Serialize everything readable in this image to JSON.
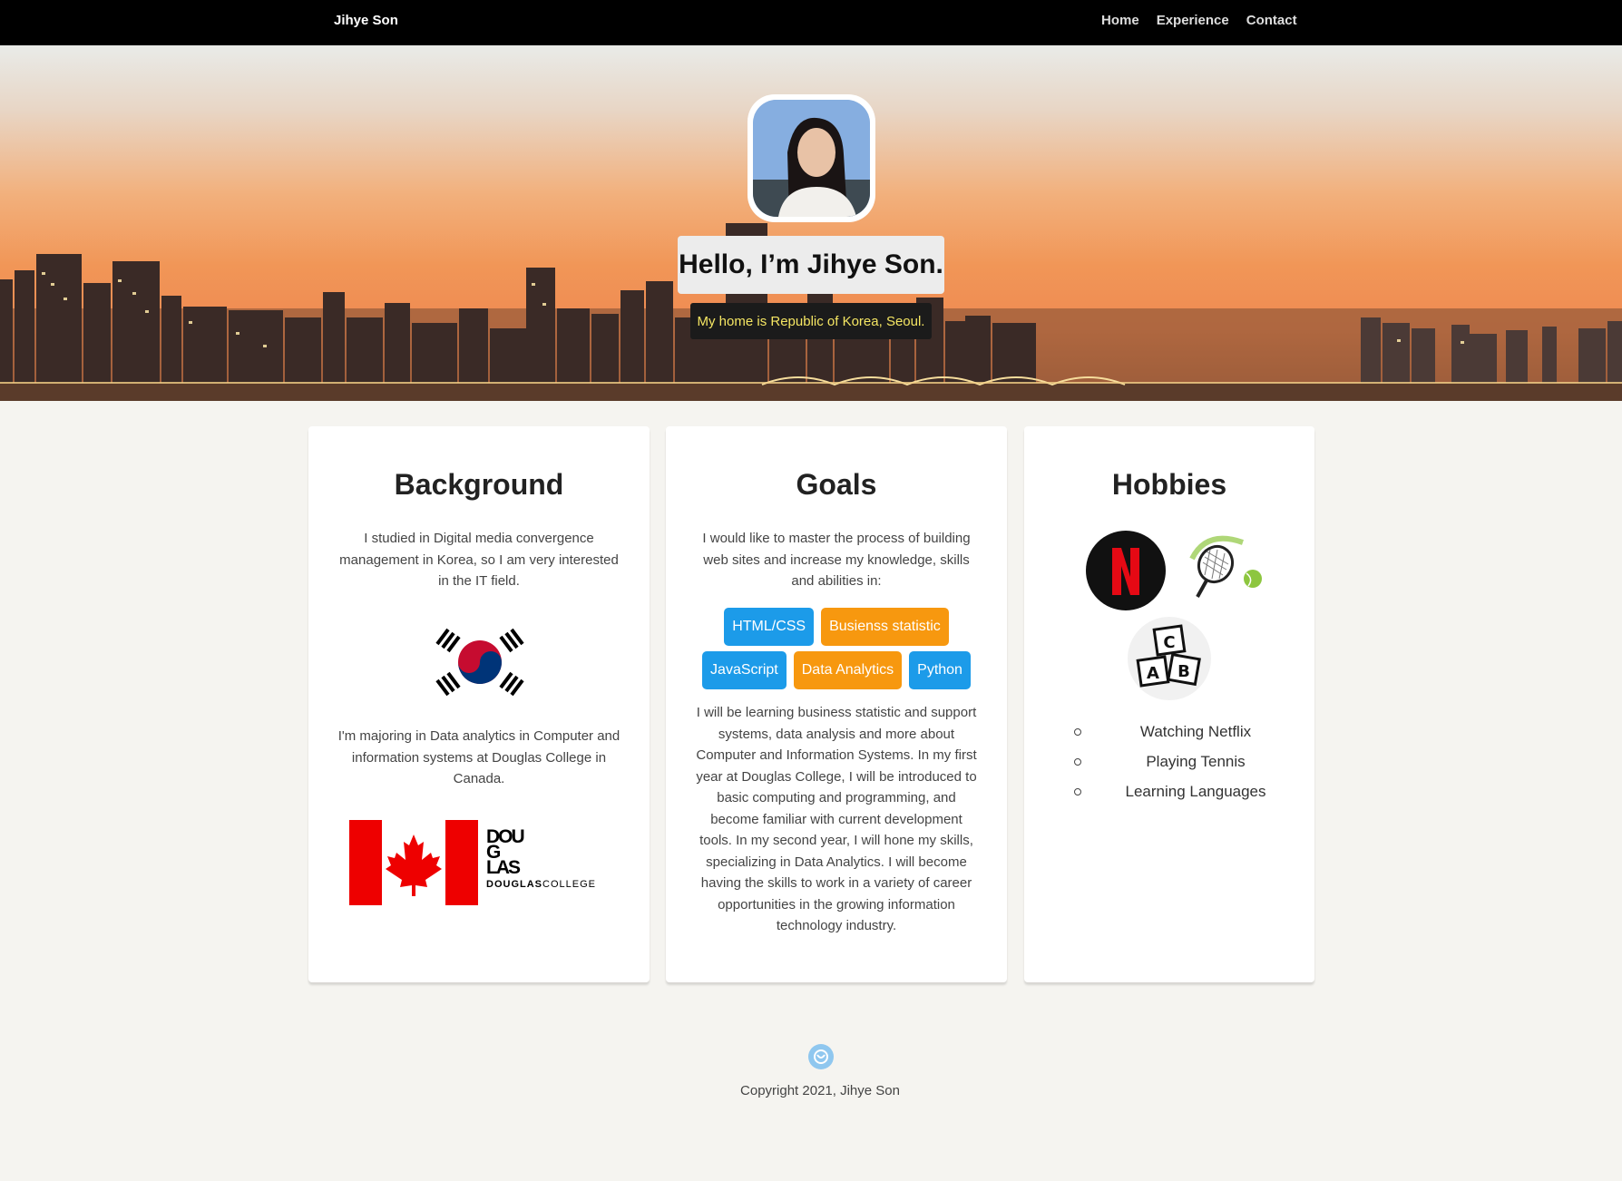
{
  "nav": {
    "brand": "Jihye Son",
    "links": [
      "Home",
      "Experience",
      "Contact"
    ]
  },
  "hero": {
    "title": "Hello, I’m Jihye Son.",
    "subtitle": "My home is Republic of Korea, Seoul."
  },
  "background": {
    "title": "Background",
    "p1": "I studied in Digital media convergence management in Korea, so I am very interested in the IT field.",
    "p2": "I'm majoring in Data analytics in Computer and information systems at Douglas College in Canada.",
    "douglas_mark": "DOUG LAS",
    "douglas_word_bold": "DOUGLAS",
    "douglas_word_light": "COLLEGE"
  },
  "goals": {
    "title": "Goals",
    "p1": "I would like to master the process of building web sites and increase my knowledge, skills and abilities in:",
    "skills_row1": [
      {
        "label": "HTML/CSS",
        "color": "#1c9be9"
      },
      {
        "label": "Busienss statistic",
        "color": "#f7980f"
      }
    ],
    "skills_row2": [
      {
        "label": "JavaScript",
        "color": "#1c9be9"
      },
      {
        "label": "Data Analytics",
        "color": "#f7980f"
      },
      {
        "label": "Python",
        "color": "#1c9be9"
      }
    ],
    "p2": "I will be learning business statistic and support systems, data analysis and more about Computer and Information Systems. In my first year at Douglas College, I will be introduced to basic computing and programming, and become familiar with current development tools. In my second year, I will hone my skills, specializing in Data Analytics. I will become having the skills to work in a variety of career opportunities in the growing information technology industry."
  },
  "hobbies": {
    "title": "Hobbies",
    "items": [
      "Watching Netflix",
      "Playing Tennis",
      "Learning Languages"
    ],
    "icons": [
      "netflix-icon",
      "tennis-icon",
      "abc-blocks-icon"
    ]
  },
  "footer": {
    "copyright": "Copyright 2021, Jihye Son"
  }
}
